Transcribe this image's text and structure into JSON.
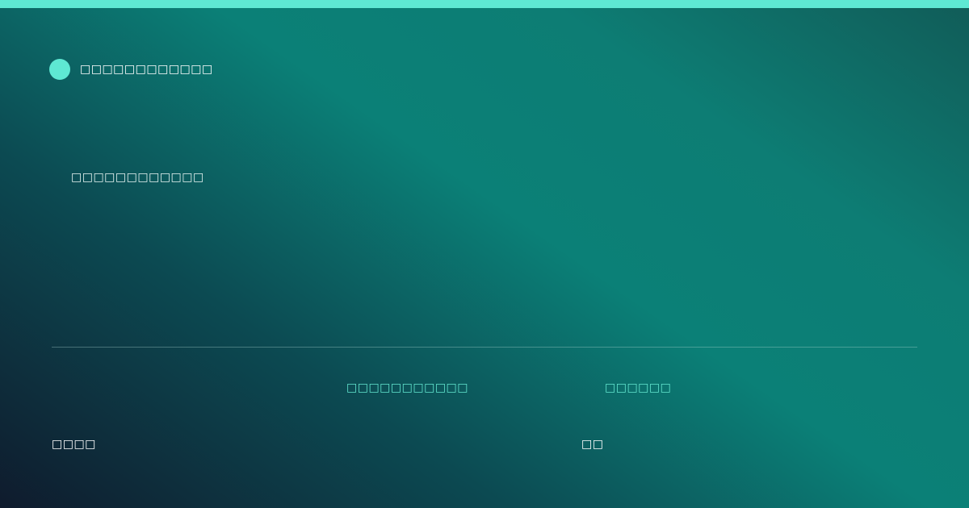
{
  "brand": {
    "name": "□□□□□□□□□□□□"
  },
  "hero": {
    "headline": "□□□□□□□□□□□□"
  },
  "meta": {
    "item_1": "□□□□□□□□□□□",
    "item_2": "□□□□□□"
  },
  "footer": {
    "left": "□□□□",
    "right": "□□"
  },
  "colors": {
    "accent": "#5ee8d3",
    "background_dark": "#0f1b2d",
    "background_teal": "#0b8077",
    "meta_text": "#63e6cf"
  },
  "icons": {
    "brand_mark": "circle-logo-icon"
  }
}
